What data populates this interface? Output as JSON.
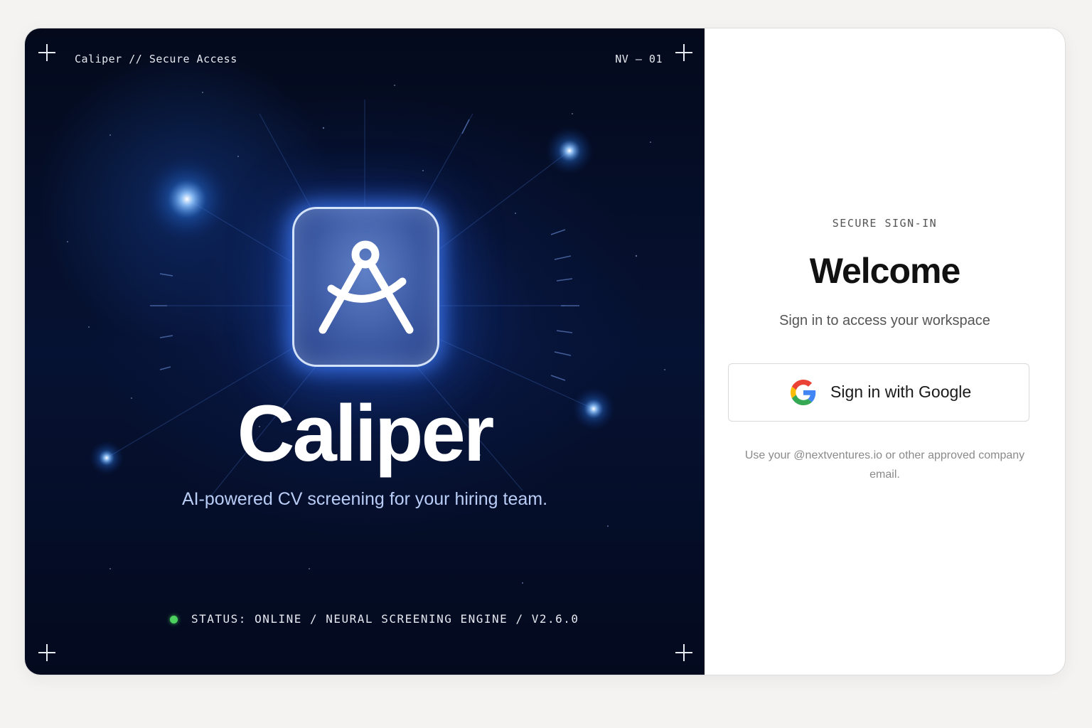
{
  "hero": {
    "window_title": "Caliper // Secure Access",
    "code": "NV — 01",
    "brand": "Caliper",
    "tagline": "AI-powered CV screening for your hiring team.",
    "status": "STATUS: ONLINE / NEURAL SCREENING ENGINE /  V2.6.0",
    "status_color": "#4cd15f",
    "icon": "caliper-compass-icon"
  },
  "signin": {
    "eyebrow": "SECURE SIGN-IN",
    "title": "Welcome",
    "subtitle": "Sign in to access your workspace",
    "google_button_label": "Sign in with Google",
    "google_icon": "google-g-icon",
    "hint": "Use your @nextventures.io or other approved company email."
  },
  "colors": {
    "hero_background": "#061233",
    "accent_glow": "#4682ff",
    "tagline": "#b9cdf7",
    "page_background": "#f4f3f1"
  }
}
